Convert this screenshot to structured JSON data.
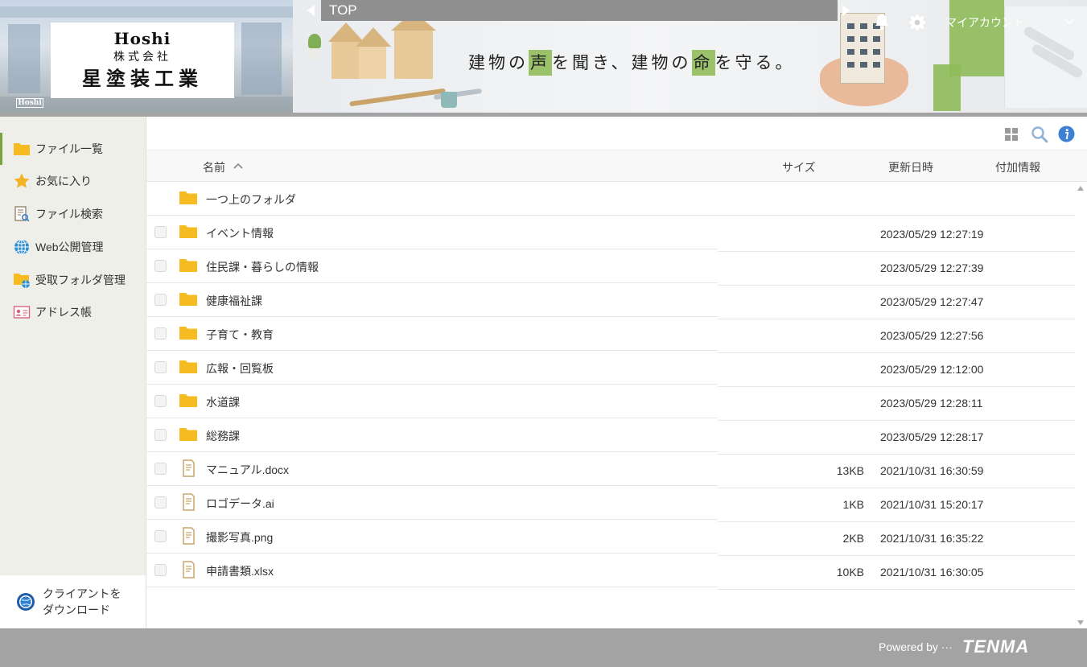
{
  "header": {
    "logo": {
      "en": "Hoshi",
      "sub": "株式会社",
      "main": "星塗装工業",
      "building_tag": "Hoshi"
    },
    "slogan": {
      "p1": "建物の",
      "h1": "声",
      "p2": "を聞き、建物の",
      "h2": "命",
      "p3": "を守る。"
    },
    "breadcrumb": "TOP",
    "account_label": "マイアカウント",
    "accent": "#9bc26a"
  },
  "sidebar": {
    "items": [
      {
        "label": "ファイル一覧",
        "icon": "folder-icon"
      },
      {
        "label": "お気に入り",
        "icon": "star-icon"
      },
      {
        "label": "ファイル検索",
        "icon": "file-search-icon"
      },
      {
        "label": "Web公開管理",
        "icon": "globe-icon"
      },
      {
        "label": "受取フォルダ管理",
        "icon": "receive-folder-icon"
      },
      {
        "label": "アドレス帳",
        "icon": "address-book-icon"
      }
    ],
    "client_download": {
      "line1": "クライアントを",
      "line2": "ダウンロード"
    }
  },
  "table": {
    "headers": {
      "name": "名前",
      "size": "サイズ",
      "updated": "更新日時",
      "extra": "付加情報"
    },
    "parent_label": "一つ上のフォルダ",
    "rows": [
      {
        "name": "イベント情報",
        "type": "folder",
        "size": "",
        "date": "2023/05/29 12:27:19"
      },
      {
        "name": "住民課・暮らしの情報",
        "type": "folder",
        "size": "",
        "date": "2023/05/29 12:27:39"
      },
      {
        "name": "健康福祉課",
        "type": "folder",
        "size": "",
        "date": "2023/05/29 12:27:47"
      },
      {
        "name": "子育て・教育",
        "type": "folder",
        "size": "",
        "date": "2023/05/29 12:27:56"
      },
      {
        "name": "広報・回覧板",
        "type": "folder",
        "size": "",
        "date": "2023/05/29 12:12:00"
      },
      {
        "name": "水道課",
        "type": "folder",
        "size": "",
        "date": "2023/05/29 12:28:11"
      },
      {
        "name": "総務課",
        "type": "folder",
        "size": "",
        "date": "2023/05/29 12:28:17"
      },
      {
        "name": "マニュアル.docx",
        "type": "file",
        "size": "13KB",
        "date": "2021/10/31 16:30:59"
      },
      {
        "name": "ロゴデータ.ai",
        "type": "file",
        "size": "1KB",
        "date": "2021/10/31 15:20:17"
      },
      {
        "name": "撮影写真.png",
        "type": "file",
        "size": "2KB",
        "date": "2021/10/31 16:35:22"
      },
      {
        "name": "申請書類.xlsx",
        "type": "file",
        "size": "10KB",
        "date": "2021/10/31 16:30:05"
      }
    ]
  },
  "footer": {
    "powered_by": "Powered by ···",
    "brand": "TENMA"
  },
  "colors": {
    "folder": "#f7bb22",
    "file_outline": "#c9a66b",
    "info": "#3d7fd3",
    "footer_bg": "#a3a3a3"
  }
}
